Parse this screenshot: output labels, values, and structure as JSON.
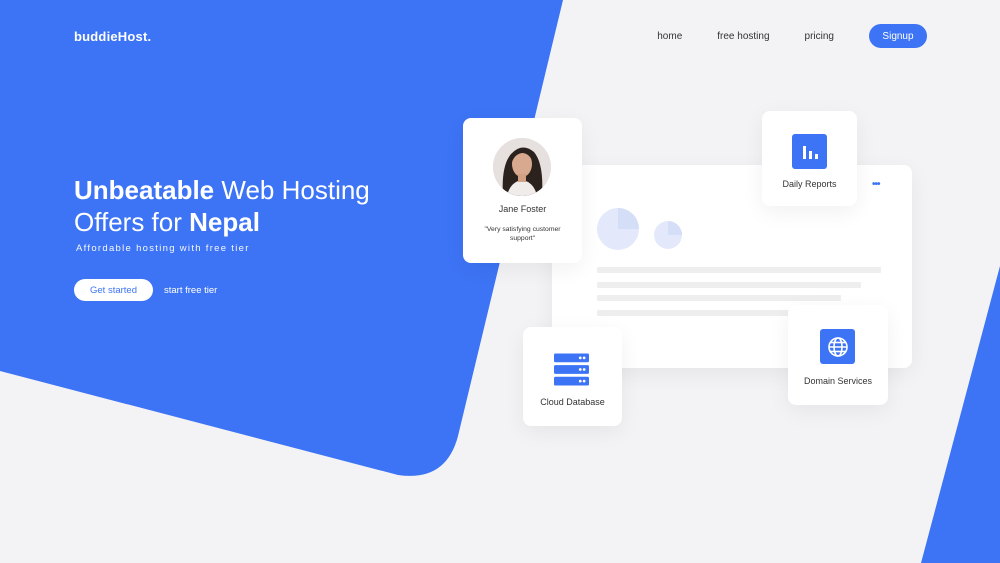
{
  "brand": {
    "name": "buddieHost.",
    "accent_color": "#3d74f5"
  },
  "nav": {
    "links": [
      {
        "label": "home"
      },
      {
        "label": "free hosting"
      },
      {
        "label": "pricing"
      }
    ],
    "signup_label": "Signup"
  },
  "hero": {
    "title_bold_1": "Unbeatable",
    "title_regular": "Web Hosting Offers for",
    "title_bold_2": "Nepal",
    "subtitle": "Affordable hosting with free tier",
    "cta_primary": "Get started",
    "cta_secondary": "start free tier"
  },
  "testimonial": {
    "name": "Jane Foster",
    "quote": "\"Very satisfying customer support\""
  },
  "features": {
    "reports": {
      "label": "Daily Reports",
      "icon": "bar-chart-icon"
    },
    "database": {
      "label": "Cloud Database",
      "icon": "server-stack-icon"
    },
    "domain": {
      "label": "Domain Services",
      "icon": "globe-icon"
    }
  },
  "dashboard": {
    "menu_icon": "more-dots-icon"
  }
}
